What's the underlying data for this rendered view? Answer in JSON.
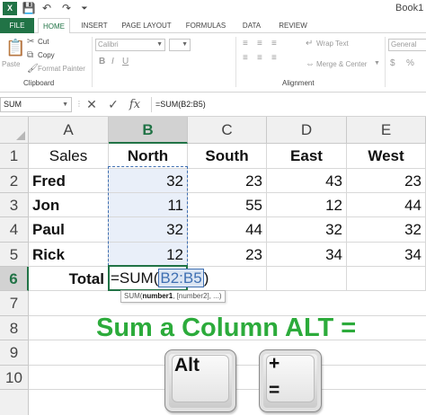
{
  "titlebar": {
    "app_logo": "X",
    "icons": [
      "save-icon",
      "undo-icon",
      "redo-icon",
      "customize-icon"
    ],
    "save_glyph": "💾",
    "undo_glyph": "↶",
    "redo_glyph": "↷",
    "customize_glyph": "⏷",
    "window_title": "Book1 -"
  },
  "ribbon_tabs": [
    "FILE",
    "HOME",
    "INSERT",
    "PAGE LAYOUT",
    "FORMULAS",
    "DATA",
    "REVIEW"
  ],
  "active_tab": "HOME",
  "ribbon": {
    "clipboard": {
      "paste_label": "Paste",
      "cut_label": "Cut",
      "copy_label": "Copy",
      "format_painter_label": "Format Painter",
      "group_label": "Clipboard"
    },
    "font": {
      "font_name": "Calibri",
      "bold": "B",
      "italic": "I",
      "underline": "U"
    },
    "alignment": {
      "wrap_text_label": "Wrap Text",
      "merge_center_label": "Merge & Center",
      "group_label": "Alignment"
    },
    "number": {
      "format": "General",
      "currency": "$",
      "percent": "%"
    }
  },
  "formula_bar": {
    "name_box": "SUM",
    "cancel_glyph": "✕",
    "enter_glyph": "✓",
    "fx_label": "fx",
    "dots": "⋮",
    "formula": "=SUM(B2:B5)"
  },
  "sheet": {
    "columns": [
      "A",
      "B",
      "C",
      "D",
      "E"
    ],
    "selected_column": "B",
    "rows": [
      "1",
      "2",
      "3",
      "4",
      "5",
      "6",
      "7",
      "8",
      "9",
      "10"
    ],
    "selected_row": "6",
    "header_row": [
      "Sales",
      "North",
      "South",
      "East",
      "West"
    ],
    "data_rows": [
      [
        "Fred",
        "32",
        "23",
        "43",
        "23"
      ],
      [
        "Jon",
        "11",
        "55",
        "12",
        "44"
      ],
      [
        "Paul",
        "32",
        "44",
        "32",
        "32"
      ],
      [
        "Rick",
        "12",
        "23",
        "34",
        "34"
      ]
    ],
    "total_label": "Total",
    "active_formula": {
      "prefix": "=SUM(",
      "range_ref": "B2:B5",
      "suffix": ")"
    },
    "tooltip": {
      "fn": "SUM(",
      "arg1": "number1",
      "rest": ", [number2], ...)"
    }
  },
  "caption": "Sum a Column ALT =",
  "keys": {
    "alt": "Alt",
    "plus": "+",
    "equals": "="
  },
  "colors": {
    "excel_green": "#217346",
    "caption_green": "#2cab3b",
    "range_blue": "#3f6fb2",
    "selection_fill": "#e9eff9"
  }
}
